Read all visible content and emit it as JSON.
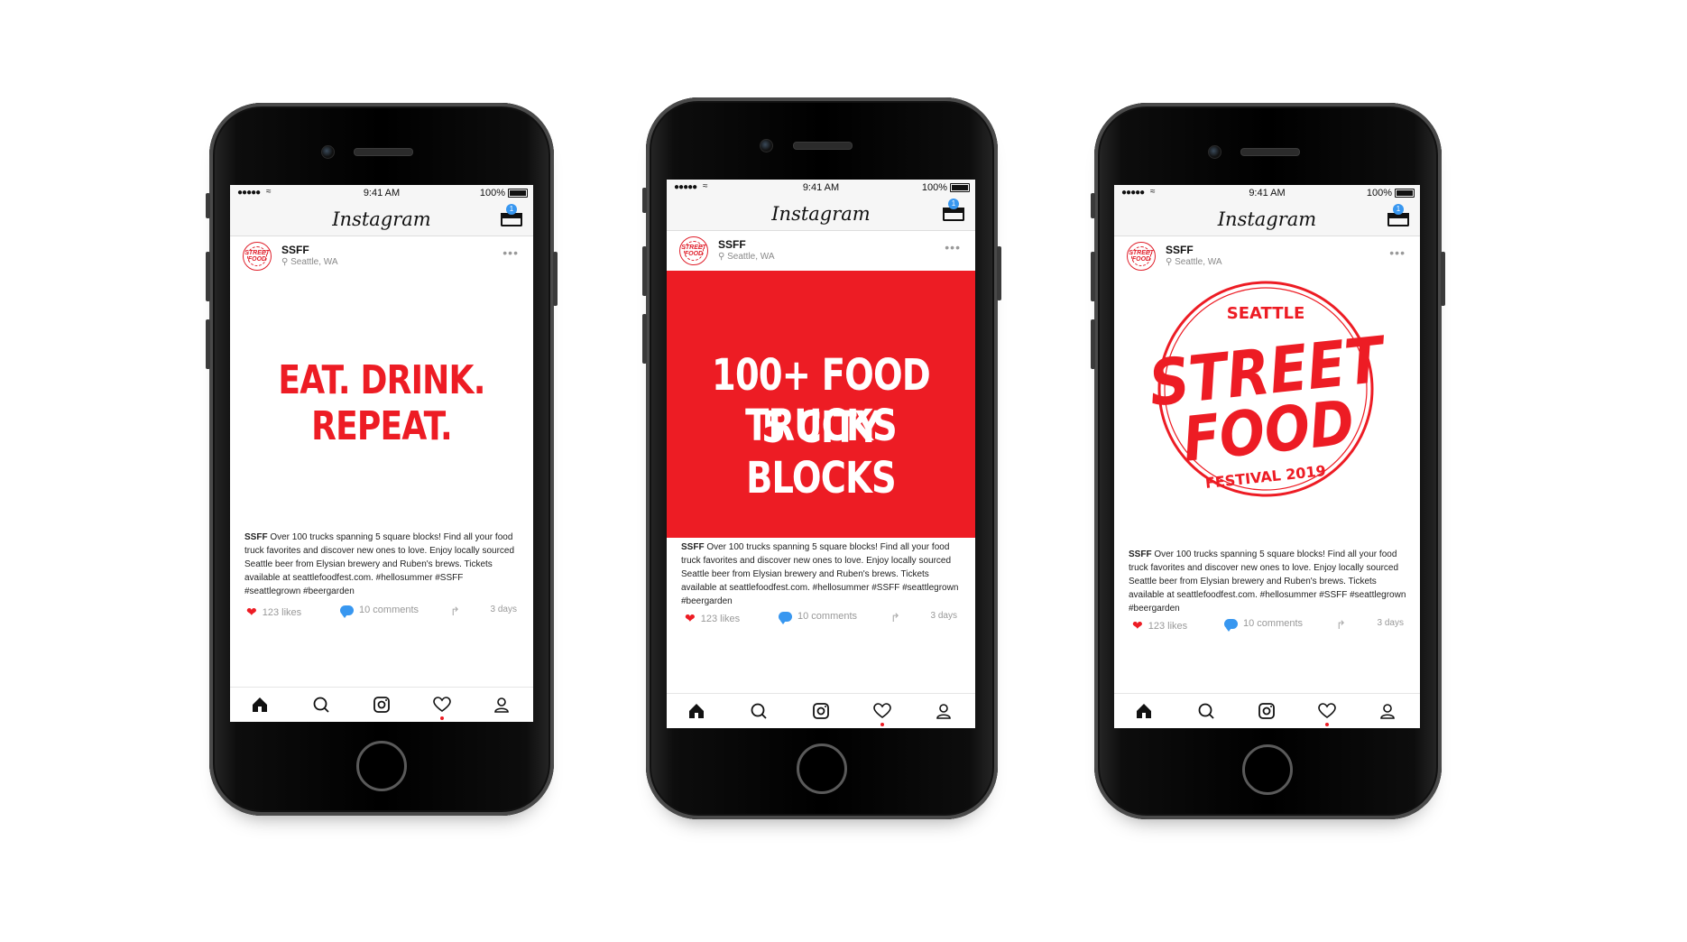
{
  "status_bar": {
    "signal": "●●●●●",
    "time": "9:41 AM",
    "battery": "100%"
  },
  "app": {
    "title": "Instagram",
    "inbox_badge": "1"
  },
  "account": {
    "username": "SSFF",
    "location": "Seattle, WA",
    "avatar_text": "STREET FOOD"
  },
  "phones": [
    {
      "caption_user": "SSFF",
      "caption_text": " Over 100 trucks spanning 5 square blocks! Find all your food truck favorites and discover new ones to love. Enjoy locally sourced Seattle beer from Elysian brewery and Ruben's brews. Tickets available at seattlefoodfest.com. #hellosummer #SSFF #seattlegrown #beergarden",
      "likes": "123 likes",
      "comments": "10 comments",
      "time_ago": "3 days",
      "headline": "EAT. DRINK. REPEAT."
    },
    {
      "caption_user": "SSFF",
      "caption_text": " Over 100 trucks spanning 5 square blocks! Find all your food truck favorites and discover new ones to love. Enjoy locally sourced Seattle beer from Elysian brewery and Ruben's brews. Tickets available at seattlefoodfest.com. #hellosummer #SSFF #seattlegrown #beergarden",
      "likes": "123 likes",
      "comments": "10 comments",
      "time_ago": "3 days",
      "headline_line1": "100+ FOOD TRUCKS",
      "headline_line2": "5 CITY BLOCKS"
    },
    {
      "caption_user": "SSFF",
      "caption_text": " Over 100 trucks spanning 5 square blocks! Find all your food truck favorites and discover new ones to love. Enjoy locally sourced Seattle beer from Elysian brewery and Ruben's brews. Tickets available at seattlefoodfest.com. #hellosummer #SSFF #seattlegrown #beergarden",
      "likes": "123 likes",
      "comments": "10 comments",
      "time_ago": "3 days",
      "logo_top": "SEATTLE",
      "logo_line1": "STREET",
      "logo_line2": "FOOD",
      "logo_bottom": "FESTIVAL 2019"
    }
  ],
  "colors": {
    "brand_red": "#ed1c24",
    "like_blue": "#3897f0"
  },
  "icons": [
    "home-icon",
    "search-icon",
    "camera-icon",
    "heart-icon",
    "profile-icon",
    "inbox-icon",
    "location-pin-icon",
    "share-icon",
    "comment-icon"
  ]
}
